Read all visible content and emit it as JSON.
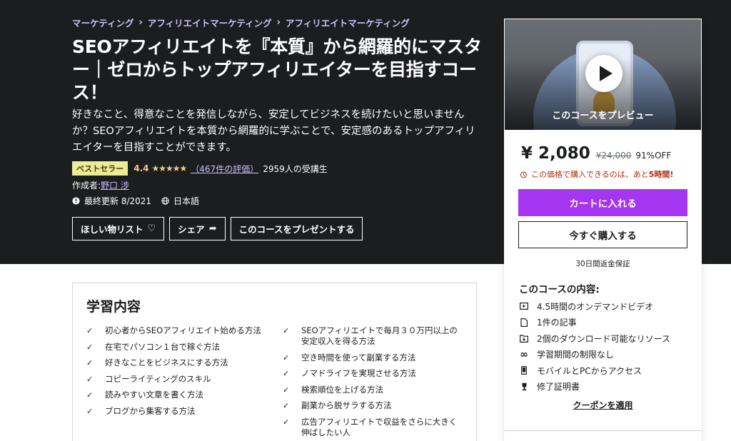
{
  "breadcrumb": [
    "マーケティング",
    "アフィリエイトマーケティング",
    "アフィリエイトマーケティング"
  ],
  "breadcrumb_separator": "›",
  "course": {
    "title": "SEOアフィリエイトを『本質』から網羅的にマスター｜ゼロからトップアフィリエイターを目指すコース！",
    "subtitle": "好きなこと、得意なことを発信しながら、安定してビジネスを続けたいと思いませんか？SEOアフィリエイトを本質から網羅的に学ぶことで、安定感のあるトップアフィリエイターを目指すことができます。",
    "badge": "ベストセラー",
    "rating": "4.4",
    "stars": "★★★★★",
    "reviews": "（467件の評価）",
    "students": "2959人の受講生",
    "author_label": "作成者:",
    "author": "野口 涉",
    "last_updated": "最終更新 8/2021",
    "language": "日本語"
  },
  "hero_buttons": {
    "wishlist": "ほしい物リスト",
    "share": "シェア",
    "gift": "このコースをプレゼントする"
  },
  "sidebar": {
    "preview_label": "このコースをプレビュー",
    "price": "¥ 2,080",
    "original_price": "¥24,000",
    "discount": "91%OFF",
    "timer_prefix": "この価格で購入できるのは、あと",
    "timer_hours": "5時間!",
    "add_to_cart": "カートに入れる",
    "buy_now": "今すぐ購入する",
    "guarantee": "30日間返金保証",
    "includes_title": "このコースの内容:",
    "includes": [
      {
        "icon": "video-icon",
        "text": "4.5時間のオンデマンドビデオ"
      },
      {
        "icon": "file-icon",
        "text": "1件の記事"
      },
      {
        "icon": "download-folder-icon",
        "text": "2個のダウンロード可能なリソース"
      },
      {
        "icon": "infinity-icon",
        "text": "学習期間の制限なし"
      },
      {
        "icon": "mobile-icon",
        "text": "モバイルとPCからアクセス"
      },
      {
        "icon": "trophy-icon",
        "text": "修了証明書"
      }
    ],
    "coupon": "クーポンを適用"
  },
  "learn": {
    "title": "学習内容",
    "col1": [
      "初心者からSEOアフィリエイト始める方法",
      "在宅でパソコン１台で稼ぐ方法",
      "好きなことをビジネスにする方法",
      "コピーライティングのスキル",
      "読みやすい文章を書く方法",
      "ブログから集客する方法"
    ],
    "col2": [
      "SEOアフィリエイトで毎月３０万円以上の安定収入を得る方法",
      "空き時間を使って副業する方法",
      "ノマドライフを実現させる方法",
      "検索順位を上げる方法",
      "副業から脱サラする方法",
      "広告アフィリエイトで収益をさらに大きく伸ばしたい人"
    ]
  },
  "colors": {
    "hero_bg": "#1c1d1f",
    "accent_purple": "#a435f0",
    "link_purple": "#cec0fc",
    "star": "#f3ca8c",
    "badge_bg": "#eceb98",
    "alert_red": "#b32d0f"
  }
}
